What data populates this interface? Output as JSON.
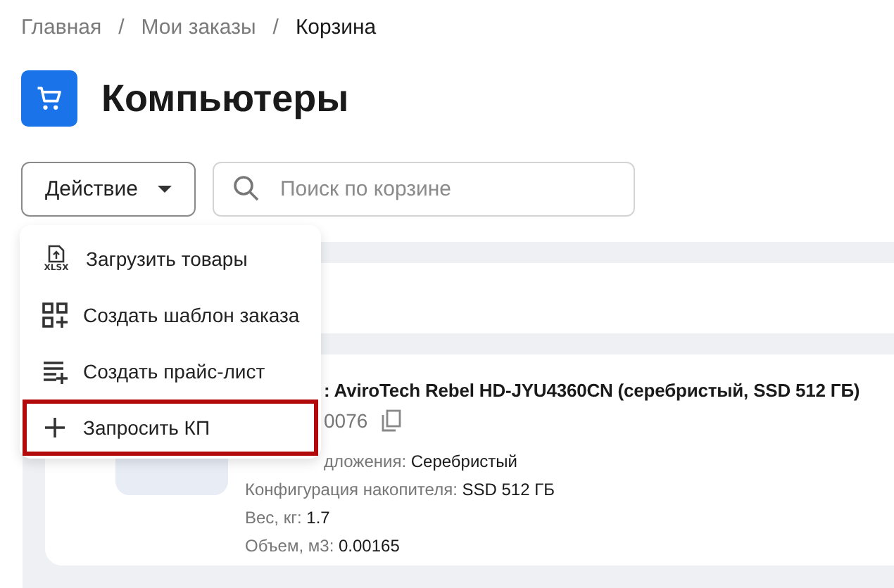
{
  "breadcrumbs": [
    {
      "label": "Главная",
      "current": false
    },
    {
      "label": "Мои заказы",
      "current": false
    },
    {
      "label": "Корзина",
      "current": true
    }
  ],
  "breadcrumb_separator": "/",
  "title": "Компьютеры",
  "action_button": {
    "label": "Действие"
  },
  "search": {
    "placeholder": "Поиск по корзине"
  },
  "menu": [
    {
      "label": "Загрузить товары",
      "kind": "upload",
      "icon_text": "XLSX",
      "highlighted": false
    },
    {
      "label": "Создать шаблон заказа",
      "kind": "template",
      "highlighted": false
    },
    {
      "label": "Создать прайс-лист",
      "kind": "pricelist",
      "highlighted": false
    },
    {
      "label": "Запросить КП",
      "kind": "request",
      "highlighted": true
    }
  ],
  "product": {
    "name": ": AviroTech Rebel HD-JYU4360CN (серебристый, SSD 512 ГБ)",
    "code": "0076",
    "properties": [
      {
        "label": "дложения: ",
        "value": "Серебристый"
      },
      {
        "label": "Конфигурация накопителя: ",
        "value": "SSD 512 ГБ"
      },
      {
        "label": "Вес, кг: ",
        "value": "1.7"
      },
      {
        "label": "Объем, м3: ",
        "value": "0.00165"
      }
    ]
  }
}
